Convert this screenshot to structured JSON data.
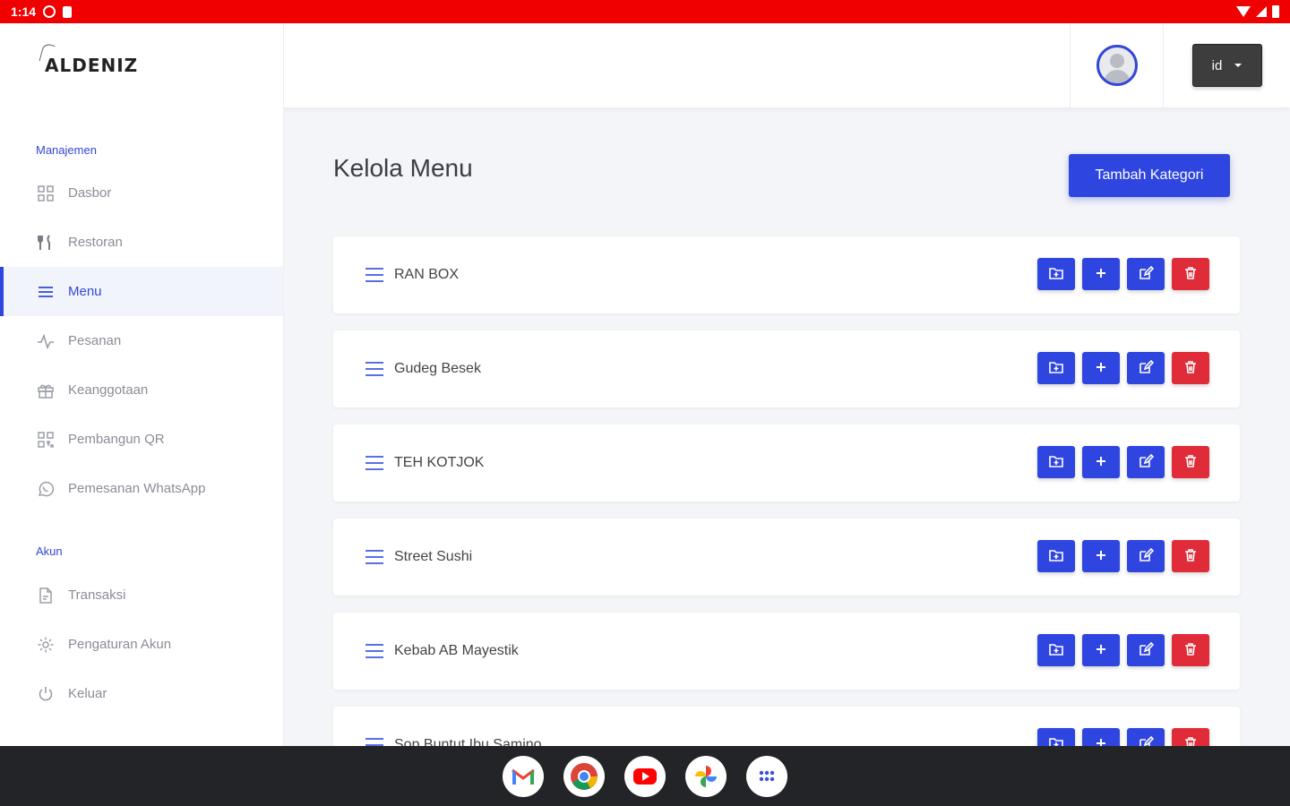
{
  "status_bar": {
    "time": "1:14"
  },
  "header": {
    "logo_text": "ALDENIZ",
    "language": "id"
  },
  "sidebar": {
    "sections": [
      {
        "label": "Manajemen"
      },
      {
        "label": "Akun"
      }
    ],
    "items": [
      {
        "label": "Dasbor",
        "icon": "dashboard-icon"
      },
      {
        "label": "Restoran",
        "icon": "utensils-icon"
      },
      {
        "label": "Menu",
        "icon": "list-icon",
        "active": true
      },
      {
        "label": "Pesanan",
        "icon": "activity-icon"
      },
      {
        "label": "Keanggotaan",
        "icon": "gift-icon"
      },
      {
        "label": "Pembangun QR",
        "icon": "qr-icon"
      },
      {
        "label": "Pemesanan WhatsApp",
        "icon": "whatsapp-icon"
      },
      {
        "label": "Transaksi",
        "icon": "document-icon"
      },
      {
        "label": "Pengaturan Akun",
        "icon": "gear-icon"
      },
      {
        "label": "Keluar",
        "icon": "power-icon"
      }
    ]
  },
  "main": {
    "title": "Kelola Menu",
    "add_category_label": "Tambah Kategori",
    "categories": [
      {
        "name": "RAN BOX"
      },
      {
        "name": "Gudeg Besek"
      },
      {
        "name": "TEH KOTJOK"
      },
      {
        "name": "Street Sushi"
      },
      {
        "name": "Kebab AB Mayestik"
      },
      {
        "name": "Sop Buntut Ibu Samino"
      }
    ]
  },
  "colors": {
    "accent": "#2f45e0",
    "danger": "#e02b38",
    "status_bar": "#f00000"
  },
  "taskbar": {
    "apps": [
      "gmail-icon",
      "chrome-icon",
      "youtube-icon",
      "photos-icon",
      "app-drawer-icon"
    ]
  }
}
